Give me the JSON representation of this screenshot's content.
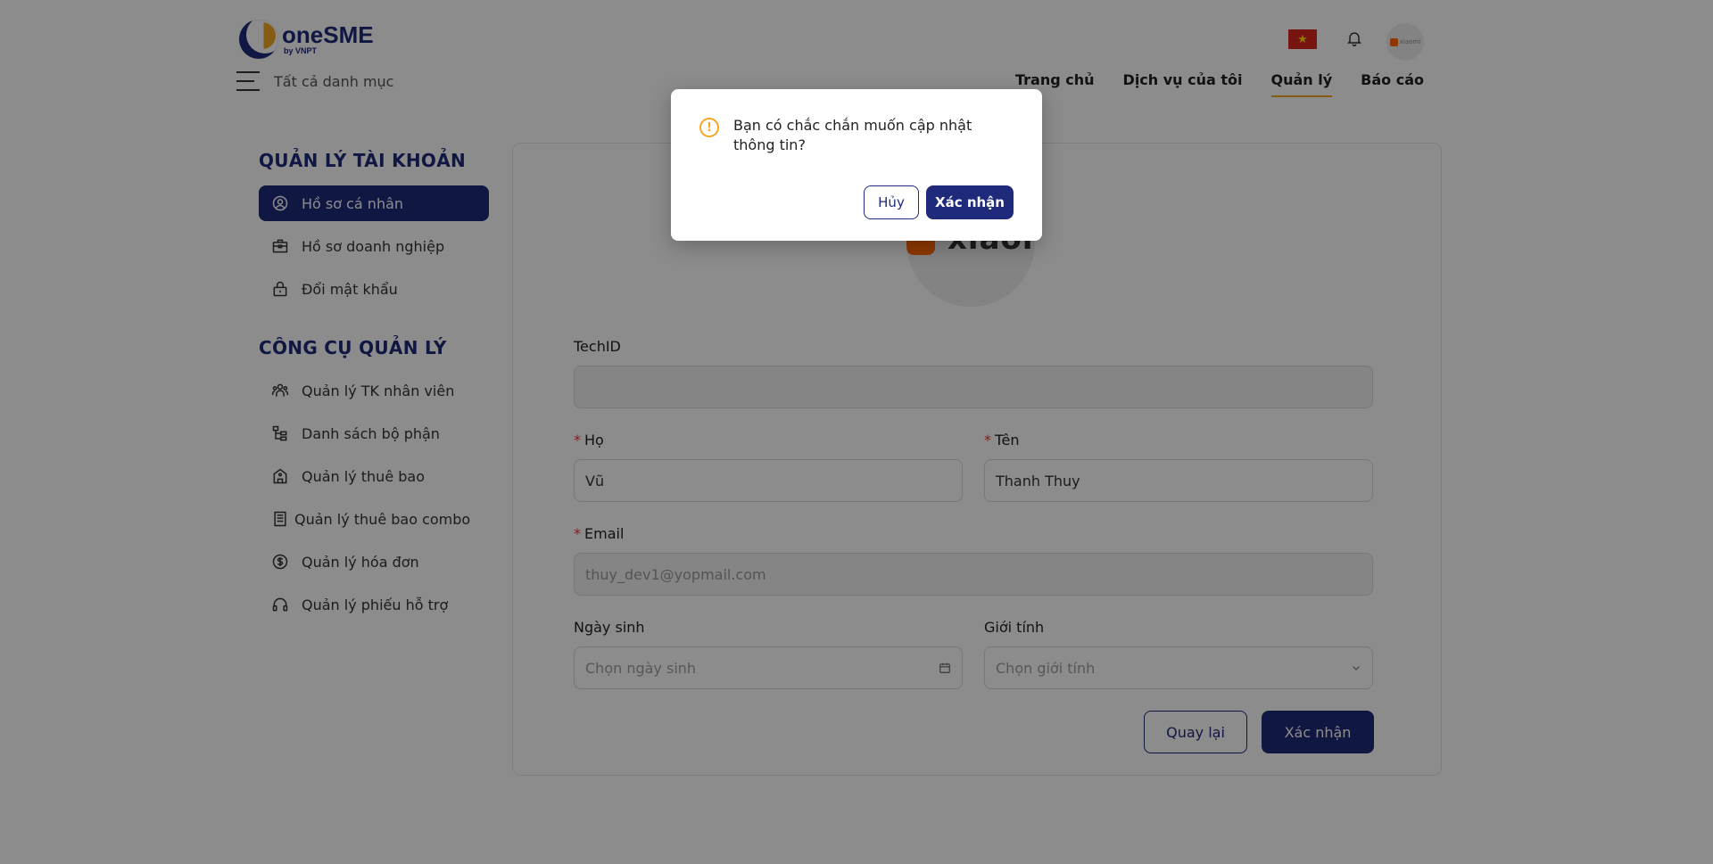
{
  "brand": {
    "name": "oneSME",
    "sub": "by VNPT"
  },
  "header": {
    "menu_label": "Tất cả danh mục",
    "nav": [
      "Trang chủ",
      "Dịch vụ của tôi",
      "Quản lý",
      "Báo cáo"
    ],
    "active_nav": "Quản lý",
    "avatar_text": "xiaomi",
    "flag": "Vietnam",
    "flag_star": "★"
  },
  "sidebar": {
    "account_title": "QUẢN LÝ TÀI KHOẢN",
    "account_items": [
      {
        "label": "Hồ sơ cá nhân",
        "icon": "user-circle-icon",
        "active": true
      },
      {
        "label": "Hồ sơ doanh nghiệp",
        "icon": "briefcase-icon"
      },
      {
        "label": "Đổi mật khẩu",
        "icon": "lock-icon"
      }
    ],
    "tools_title": "CÔNG CỤ QUẢN LÝ",
    "tools_items": [
      {
        "label": "Quản lý TK nhân viên",
        "icon": "users-icon"
      },
      {
        "label": "Danh sách bộ phận",
        "icon": "hierarchy-icon"
      },
      {
        "label": "Quản lý thuê bao",
        "icon": "building-icon"
      },
      {
        "label": "Quản lý thuê bao combo",
        "icon": "combo-icon"
      },
      {
        "label": "Quản lý hóa đơn",
        "icon": "dollar-icon"
      },
      {
        "label": "Quản lý phiếu hỗ trợ",
        "icon": "headset-icon"
      }
    ]
  },
  "profile": {
    "avatar_brand": "xiaomi",
    "techid": {
      "label": "TechID",
      "value": ""
    },
    "ho": {
      "label": "Họ",
      "value": "Vũ",
      "required": true
    },
    "ten": {
      "label": "Tên",
      "value": "Thanh Thuy",
      "required": true
    },
    "email": {
      "label": "Email",
      "value": "thuy_dev1@yopmail.com",
      "required": true
    },
    "birthday": {
      "label": "Ngày sinh",
      "placeholder": "Chọn ngày sinh"
    },
    "gender": {
      "label": "Giới tính",
      "placeholder": "Chọn giới tính"
    },
    "back_label": "Quay lại",
    "submit_label": "Xác nhận",
    "required_mark": "*"
  },
  "modal": {
    "icon_glyph": "!",
    "message": "Bạn có chắc chắn muốn cập nhật thông tin?",
    "cancel_label": "Hủy",
    "confirm_label": "Xác nhận"
  },
  "colors": {
    "primary": "#1f2a7a",
    "accent": "#f5a623",
    "required": "#e53935",
    "overlay": "rgba(0,0,0,0.45)"
  }
}
